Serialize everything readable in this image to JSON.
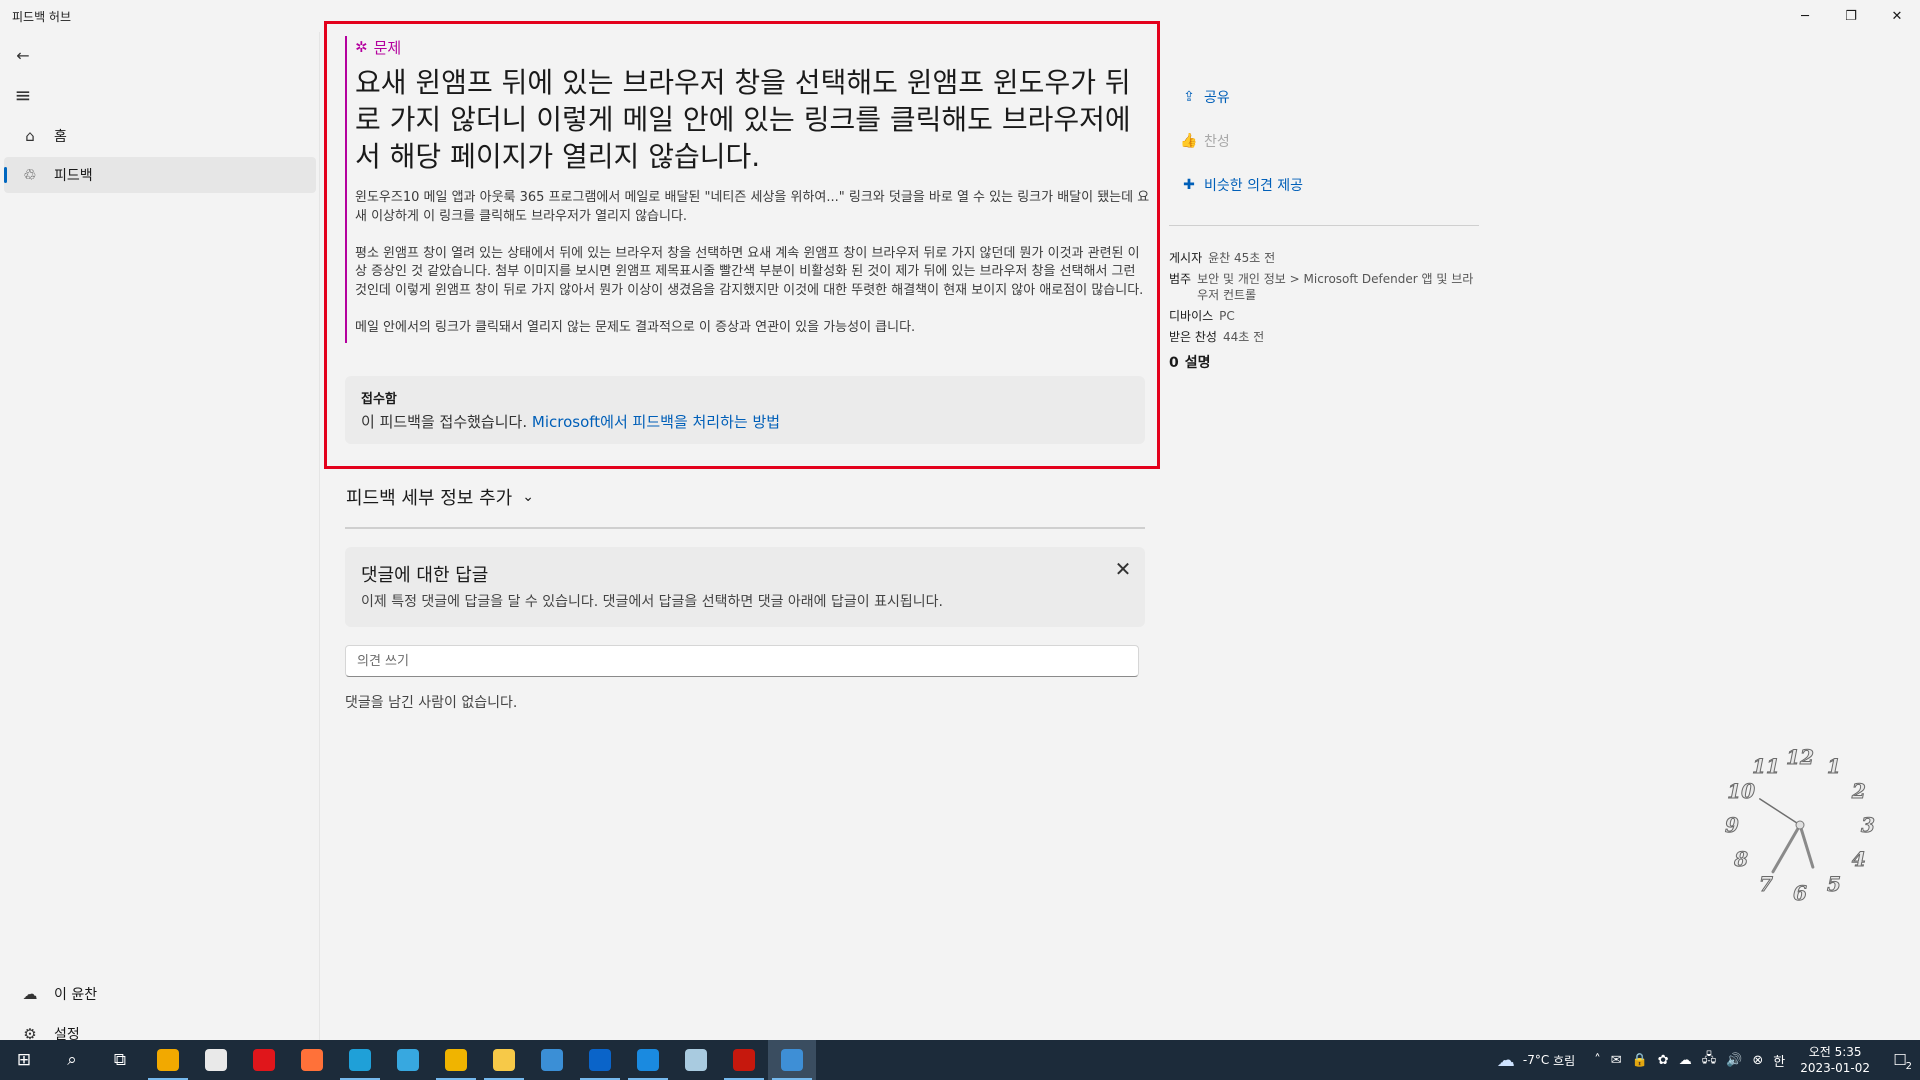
{
  "window": {
    "title": "피드백 허브",
    "minimize_glyph": "─",
    "restore_glyph": "❐",
    "close_glyph": "✕"
  },
  "nav": {
    "back_glyph": "←",
    "menu_glyph": "≡",
    "items": [
      {
        "label": "홈",
        "icon": "home-icon",
        "glyph": "⌂"
      },
      {
        "label": "피드백",
        "icon": "feedback-icon",
        "glyph": "♲",
        "selected": true
      }
    ],
    "account_label": "이 윤찬",
    "account_glyph": "☁",
    "settings_label": "설정",
    "settings_glyph": "⚙"
  },
  "post": {
    "category": "문제",
    "category_glyph": "✲",
    "title": "요새 윈앰프 뒤에 있는 브라우저 창을 선택해도 윈앰프 윈도우가 뒤로 가지 않더니 이렇게 메일 안에 있는 링크를 클릭해도 브라우저에서 해당 페이지가 열리지 않습니다.",
    "paragraphs": [
      "윈도우즈10 메일 앱과 아웃룩 365 프로그램에서 메일로 배달된 \"네티즌 세상을 위하여...\" 링크와 덧글을 바로 열 수 있는 링크가 배달이 됐는데 요새 이상하게 이 링크를 클릭해도 브라우저가 열리지 않습니다.",
      "평소 윈앰프 창이 열려 있는 상태에서 뒤에 있는 브라우저 창을 선택하면 요새 계속 윈앰프 창이 브라우저 뒤로 가지 않던데 뭔가 이것과 관련된 이상 증상인 것 같았습니다. 첨부 이미지를 보시면 윈앰프 제목표시줄 빨간색 부분이 비활성화 된 것이 제가 뒤에 있는 브라우저 창을 선택해서 그런 것인데 이렇게 윈앰프 창이 뒤로 가지 않아서 뭔가 이상이 생겼음을 감지했지만 이것에 대한 뚜렷한 해결책이 현재 보이지 않아 애로점이 많습니다.",
      "메일 안에서의 링크가 클릭돼서 열리지 않는 문제도 결과적으로 이 증상과 연관이 있을 가능성이 큽니다."
    ],
    "status_title": "접수함",
    "status_text": "이 피드백을 접수했습니다.",
    "status_link": "Microsoft에서 피드백을 처리하는 방법"
  },
  "details": {
    "label": "피드백 세부 정보 추가",
    "chevron": "⌄"
  },
  "tip": {
    "title": "댓글에 대한 답글",
    "text": "이제 특정 댓글에 답글을 달 수 있습니다. 댓글에서 답글을 선택하면 댓글 아래에 답글이 표시됩니다.",
    "close_glyph": "✕"
  },
  "comments": {
    "placeholder": "의견 쓰기",
    "empty_text": "댓글을 남긴 사람이 없습니다."
  },
  "side": {
    "share_label": "공유",
    "share_glyph": "⇪",
    "upvote_label": "찬성",
    "upvote_glyph": "👍",
    "similar_label": "비슷한 의견 제공",
    "similar_glyph": "✚",
    "meta": [
      {
        "key": "게시자",
        "value": "윤찬 45초 전"
      },
      {
        "key": "범주",
        "value": "보안 및 개인 정보 > Microsoft Defender 앱 및 브라우저 컨트롤"
      },
      {
        "key": "디바이스",
        "value": "PC"
      },
      {
        "key": "받은 찬성",
        "value": "44초 전"
      }
    ],
    "comment_count": "0",
    "comment_count_label": "설명"
  },
  "clock": {
    "numbers": [
      "12",
      "1",
      "2",
      "3",
      "4",
      "5",
      "6",
      "7",
      "8",
      "9",
      "10",
      "11"
    ],
    "hour_hand_deg": 163,
    "minute_hand_deg": 210,
    "second_hand_deg": 303
  },
  "taskbar": {
    "start_glyph": "⊞",
    "search_glyph": "⌕",
    "taskview_glyph": "⧉",
    "apps": [
      {
        "name": "winamp-icon",
        "color": "#f2a900",
        "running": true
      },
      {
        "name": "clock-app-icon",
        "color": "#e9e9e9",
        "running": false
      },
      {
        "name": "opera-icon",
        "color": "#e0161b",
        "running": false
      },
      {
        "name": "firefox-icon",
        "color": "#ff7139",
        "running": false
      },
      {
        "name": "edge-icon",
        "color": "#1fa0d8",
        "running": true
      },
      {
        "name": "bird-app-icon",
        "color": "#37a8e0",
        "running": false
      },
      {
        "name": "chrome-icon",
        "color": "#f0b400",
        "running": true
      },
      {
        "name": "file-explorer-icon",
        "color": "#f7c948",
        "running": true
      },
      {
        "name": "store-icon",
        "color": "#3b8fd6",
        "running": false
      },
      {
        "name": "outlook-icon",
        "color": "#0a64c9",
        "running": true
      },
      {
        "name": "mail-icon",
        "color": "#1a8ae0",
        "running": true
      },
      {
        "name": "notepad-icon",
        "color": "#a9cbe0",
        "running": false
      },
      {
        "name": "filezilla-icon",
        "color": "#c6180d",
        "running": true
      },
      {
        "name": "feedback-hub-icon",
        "color": "#3e8fd6",
        "running": true,
        "active": true
      }
    ],
    "weather_temp": "-7°C",
    "weather_desc": "흐림",
    "tray_glyphs": [
      "˄",
      "✉",
      "🔒",
      "✿",
      "☁",
      "🖧",
      "🔊",
      "⊗",
      "한"
    ],
    "time": "오전 5:35",
    "date": "2023-01-02",
    "notif_glyph": "☐",
    "notif_count": "2"
  }
}
